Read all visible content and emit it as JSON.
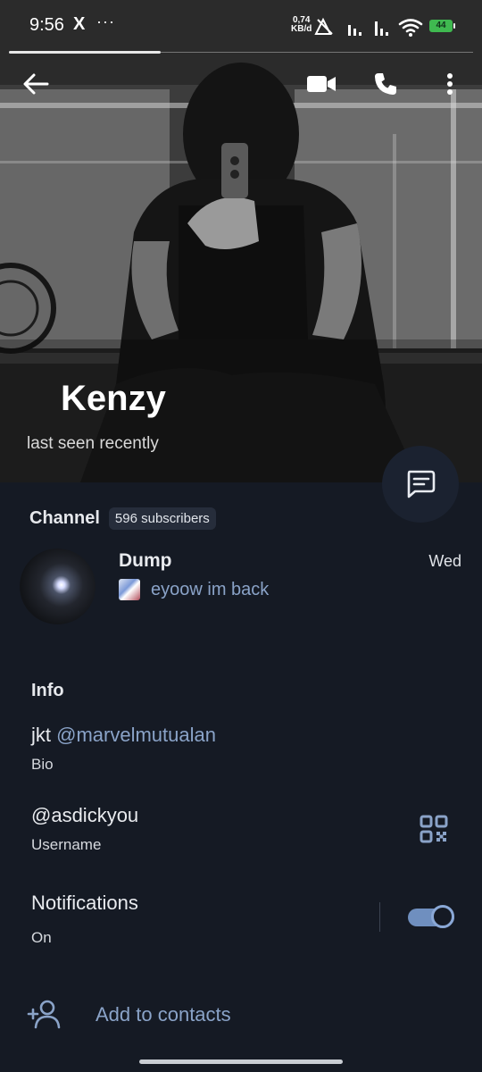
{
  "status_bar": {
    "time": "9:56",
    "x_icon": "X",
    "dots": "···",
    "net_speed_value": "0,74",
    "net_speed_unit": "KB/d",
    "battery": "44"
  },
  "toolbar": {
    "back_icon": "arrow-left-icon",
    "video_icon": "video-camera-icon",
    "call_icon": "phone-icon",
    "more_icon": "more-vertical-icon"
  },
  "profile": {
    "name": "Kenzy",
    "status": "last seen recently"
  },
  "channel": {
    "title": "Channel",
    "subscribers": "596 subscribers",
    "name": "Dump",
    "date": "Wed",
    "preview": "eyoow im back"
  },
  "info": {
    "title": "Info",
    "bio_prefix": "jkt",
    "bio_link": "@marvelmutualan",
    "bio_label": "Bio",
    "username": "@asdickyou",
    "username_label": "Username",
    "notifications_label": "Notifications",
    "notifications_value": "On",
    "notifications_enabled": true
  },
  "actions": {
    "add_contacts": "Add to contacts"
  },
  "colors": {
    "background": "#151a24",
    "accent": "#8aa3c8",
    "toggle_on": "#6f8fbf"
  }
}
